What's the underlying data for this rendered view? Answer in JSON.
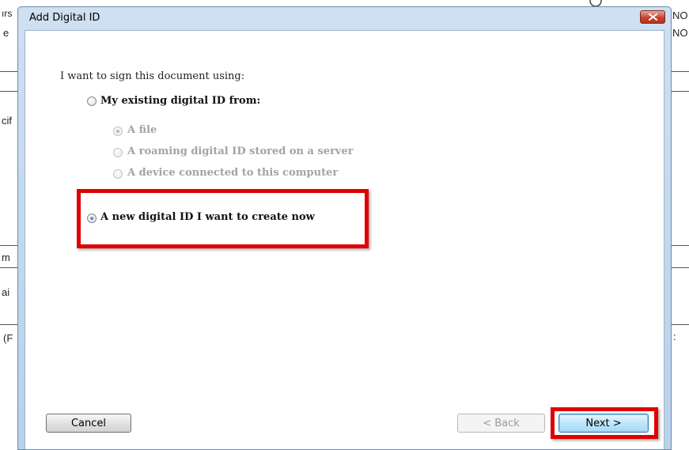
{
  "background": {
    "left_fragments": [
      "ırs",
      "e",
      "cif",
      "m",
      "ai",
      "(F"
    ],
    "right_fragments": [
      "NO",
      "NO",
      ":"
    ]
  },
  "dialog": {
    "title": "Add Digital ID",
    "prompt": "I want to sign this document using:",
    "options": {
      "existing_label": "My existing digital ID from:",
      "existing_selected": false,
      "sub_options": [
        {
          "label": "A file",
          "selected": true,
          "enabled": false
        },
        {
          "label": "A roaming digital ID stored on a server",
          "selected": false,
          "enabled": false
        },
        {
          "label": "A device connected to this computer",
          "selected": false,
          "enabled": false
        }
      ],
      "new_label": "A new digital ID I want to create now",
      "new_selected": true
    },
    "buttons": {
      "cancel": "Cancel",
      "back": "< Back",
      "next": "Next >"
    },
    "highlight_color": "#e00000"
  }
}
